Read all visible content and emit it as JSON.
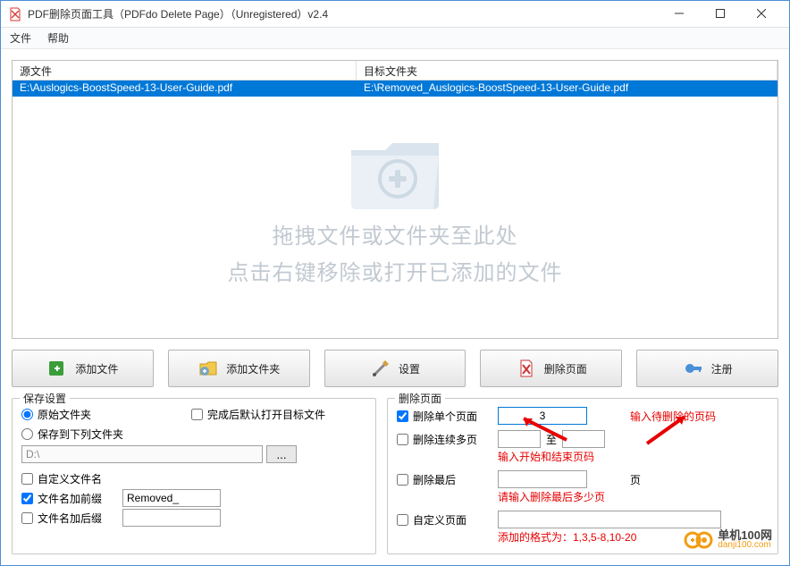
{
  "window": {
    "title": "PDF删除页面工具（PDFdo Delete Page）（Unregistered）v2.4"
  },
  "menubar": {
    "file": "文件",
    "help": "帮助"
  },
  "table": {
    "col1": "源文件",
    "col2": "目标文件夹",
    "row1_src": "E:\\Auslogics-BoostSpeed-13-User-Guide.pdf",
    "row1_dst": "E:\\Removed_Auslogics-BoostSpeed-13-User-Guide.pdf"
  },
  "dropzone": {
    "line1": "拖拽文件或文件夹至此处",
    "line2": "点击右键移除或打开已添加的文件"
  },
  "buttons": {
    "addfile": "添加文件",
    "addfolder": "添加文件夹",
    "settings": "设置",
    "delete": "删除页面",
    "register": "注册"
  },
  "save": {
    "legend": "保存设置",
    "opt_original": "原始文件夹",
    "opt_below": "保存到下列文件夹",
    "path": "D:\\",
    "chk_customname": "自定义文件名",
    "chk_prefix": "文件名加前缀",
    "prefix_value": "Removed_",
    "chk_suffix": "文件名加后缀",
    "chk_openafter": "完成后默认打开目标文件"
  },
  "del": {
    "legend": "删除页面",
    "single": "删除单个页面",
    "single_val": "3",
    "single_hint": "输入待删除的页码",
    "range": "删除连续多页",
    "to": "至",
    "range_hint": "输入开始和结束页码",
    "last": "删除最后",
    "page_unit": "页",
    "last_hint": "请输入删除最后多少页",
    "custom": "自定义页面",
    "custom_hint": "添加的格式为：1,3,5-8,10-20"
  },
  "watermark": {
    "brand": "单机100网",
    "url": "danji100.com"
  }
}
